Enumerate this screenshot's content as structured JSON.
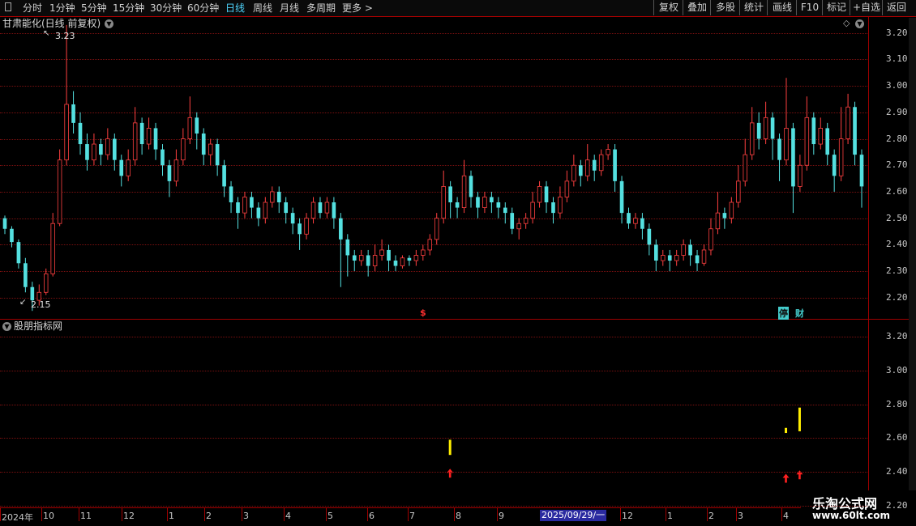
{
  "toolbar": {
    "periods": [
      "分时",
      "1分钟",
      "5分钟",
      "15分钟",
      "30分钟",
      "60分钟",
      "日线",
      "周线",
      "月线",
      "多周期",
      "更多 >"
    ],
    "active_period": "日线",
    "right_buttons": [
      "复权",
      "叠加",
      "多股",
      "统计",
      "画线",
      "F10",
      "标记",
      "+自选",
      "返回"
    ]
  },
  "main_panel": {
    "title": "甘肃能化(日线 前复权)",
    "y_ticks": [
      "3.20",
      "3.10",
      "3.00",
      "2.90",
      "2.80",
      "2.70",
      "2.60",
      "2.50",
      "2.40",
      "2.30",
      "2.20"
    ],
    "high_label": "3.23",
    "low_label": "2.15",
    "tag_s": "$",
    "tag_ting": "停",
    "tag_cai": "财"
  },
  "sub_panel": {
    "title": "股朋指标网",
    "y_ticks": [
      "3.20",
      "3.00",
      "2.80",
      "2.60",
      "2.40",
      "2.20"
    ]
  },
  "x_axis": {
    "labels": [
      "2024年",
      "10",
      "11",
      "12",
      "1",
      "2",
      "3",
      "4",
      "5",
      "6",
      "7",
      "8",
      "9",
      "12",
      "1",
      "2",
      "3",
      "4"
    ],
    "selected_date": "2025/09/29/一"
  },
  "watermark": {
    "line1": "乐淘公式网",
    "line2": "www.60lt.com"
  },
  "colors": {
    "up": "#ff4040",
    "down": "#54e0e0",
    "signal": "#ffee00",
    "arrow": "#ff2020"
  },
  "chart_data": {
    "type": "candlestick",
    "ylim": [
      2.12,
      3.26
    ],
    "candles": [
      [
        2.5,
        2.46,
        2.51,
        2.44
      ],
      [
        2.46,
        2.41,
        2.47,
        2.39
      ],
      [
        2.41,
        2.33,
        2.42,
        2.31
      ],
      [
        2.33,
        2.24,
        2.35,
        2.22
      ],
      [
        2.24,
        2.19,
        2.26,
        2.15
      ],
      [
        2.19,
        2.22,
        2.25,
        2.17
      ],
      [
        2.22,
        2.29,
        2.31,
        2.21
      ],
      [
        2.29,
        2.48,
        2.52,
        2.28
      ],
      [
        2.48,
        2.72,
        2.76,
        2.47
      ],
      [
        2.72,
        2.93,
        3.23,
        2.7
      ],
      [
        2.93,
        2.86,
        2.98,
        2.82
      ],
      [
        2.86,
        2.78,
        2.9,
        2.74
      ],
      [
        2.78,
        2.72,
        2.82,
        2.68
      ],
      [
        2.72,
        2.78,
        2.82,
        2.7
      ],
      [
        2.78,
        2.74,
        2.8,
        2.7
      ],
      [
        2.74,
        2.8,
        2.84,
        2.72
      ],
      [
        2.8,
        2.72,
        2.82,
        2.68
      ],
      [
        2.72,
        2.66,
        2.74,
        2.62
      ],
      [
        2.66,
        2.72,
        2.76,
        2.64
      ],
      [
        2.72,
        2.86,
        2.92,
        2.7
      ],
      [
        2.86,
        2.78,
        2.88,
        2.74
      ],
      [
        2.78,
        2.84,
        2.88,
        2.76
      ],
      [
        2.84,
        2.76,
        2.86,
        2.72
      ],
      [
        2.76,
        2.7,
        2.78,
        2.66
      ],
      [
        2.7,
        2.64,
        2.72,
        2.58
      ],
      [
        2.64,
        2.72,
        2.76,
        2.62
      ],
      [
        2.72,
        2.8,
        2.84,
        2.7
      ],
      [
        2.8,
        2.88,
        2.96,
        2.78
      ],
      [
        2.88,
        2.82,
        2.9,
        2.76
      ],
      [
        2.82,
        2.74,
        2.84,
        2.7
      ],
      [
        2.74,
        2.78,
        2.8,
        2.7
      ],
      [
        2.78,
        2.7,
        2.8,
        2.66
      ],
      [
        2.7,
        2.62,
        2.72,
        2.58
      ],
      [
        2.62,
        2.56,
        2.64,
        2.52
      ],
      [
        2.56,
        2.52,
        2.58,
        2.46
      ],
      [
        2.52,
        2.58,
        2.6,
        2.5
      ],
      [
        2.58,
        2.54,
        2.6,
        2.5
      ],
      [
        2.54,
        2.5,
        2.56,
        2.47
      ],
      [
        2.5,
        2.56,
        2.58,
        2.48
      ],
      [
        2.56,
        2.6,
        2.62,
        2.54
      ],
      [
        2.6,
        2.56,
        2.62,
        2.52
      ],
      [
        2.56,
        2.52,
        2.58,
        2.48
      ],
      [
        2.52,
        2.48,
        2.54,
        2.44
      ],
      [
        2.48,
        2.44,
        2.5,
        2.38
      ],
      [
        2.44,
        2.5,
        2.52,
        2.42
      ],
      [
        2.5,
        2.56,
        2.58,
        2.48
      ],
      [
        2.56,
        2.52,
        2.58,
        2.5
      ],
      [
        2.52,
        2.56,
        2.58,
        2.5
      ],
      [
        2.56,
        2.5,
        2.58,
        2.46
      ],
      [
        2.5,
        2.42,
        2.52,
        2.24
      ],
      [
        2.42,
        2.36,
        2.44,
        2.28
      ],
      [
        2.36,
        2.34,
        2.38,
        2.3
      ],
      [
        2.34,
        2.36,
        2.38,
        2.32
      ],
      [
        2.36,
        2.32,
        2.38,
        2.28
      ],
      [
        2.32,
        2.36,
        2.4,
        2.3
      ],
      [
        2.36,
        2.38,
        2.42,
        2.34
      ],
      [
        2.38,
        2.34,
        2.4,
        2.3
      ],
      [
        2.34,
        2.32,
        2.36,
        2.3
      ],
      [
        2.32,
        2.35,
        2.36,
        2.31
      ],
      [
        2.35,
        2.34,
        2.36,
        2.32
      ],
      [
        2.34,
        2.36,
        2.38,
        2.32
      ],
      [
        2.36,
        2.38,
        2.4,
        2.34
      ],
      [
        2.38,
        2.42,
        2.44,
        2.36
      ],
      [
        2.42,
        2.5,
        2.52,
        2.4
      ],
      [
        2.5,
        2.62,
        2.68,
        2.48
      ],
      [
        2.62,
        2.56,
        2.64,
        2.5
      ],
      [
        2.56,
        2.54,
        2.58,
        2.5
      ],
      [
        2.54,
        2.66,
        2.72,
        2.52
      ],
      [
        2.66,
        2.58,
        2.68,
        2.54
      ],
      [
        2.58,
        2.54,
        2.6,
        2.5
      ],
      [
        2.54,
        2.58,
        2.6,
        2.52
      ],
      [
        2.58,
        2.56,
        2.6,
        2.52
      ],
      [
        2.56,
        2.54,
        2.58,
        2.5
      ],
      [
        2.54,
        2.52,
        2.56,
        2.48
      ],
      [
        2.52,
        2.46,
        2.54,
        2.44
      ],
      [
        2.46,
        2.48,
        2.5,
        2.42
      ],
      [
        2.48,
        2.5,
        2.52,
        2.46
      ],
      [
        2.5,
        2.56,
        2.6,
        2.48
      ],
      [
        2.56,
        2.62,
        2.64,
        2.54
      ],
      [
        2.62,
        2.56,
        2.64,
        2.52
      ],
      [
        2.56,
        2.52,
        2.58,
        2.48
      ],
      [
        2.52,
        2.58,
        2.62,
        2.5
      ],
      [
        2.58,
        2.64,
        2.68,
        2.56
      ],
      [
        2.64,
        2.7,
        2.74,
        2.62
      ],
      [
        2.7,
        2.66,
        2.72,
        2.62
      ],
      [
        2.66,
        2.72,
        2.78,
        2.64
      ],
      [
        2.72,
        2.68,
        2.74,
        2.64
      ],
      [
        2.68,
        2.74,
        2.76,
        2.66
      ],
      [
        2.74,
        2.76,
        2.78,
        2.72
      ],
      [
        2.76,
        2.64,
        2.78,
        2.6
      ],
      [
        2.64,
        2.52,
        2.66,
        2.48
      ],
      [
        2.52,
        2.48,
        2.54,
        2.46
      ],
      [
        2.48,
        2.5,
        2.52,
        2.46
      ],
      [
        2.5,
        2.46,
        2.52,
        2.42
      ],
      [
        2.46,
        2.4,
        2.48,
        2.36
      ],
      [
        2.4,
        2.34,
        2.42,
        2.3
      ],
      [
        2.34,
        2.36,
        2.38,
        2.32
      ],
      [
        2.36,
        2.34,
        2.38,
        2.3
      ],
      [
        2.34,
        2.36,
        2.38,
        2.32
      ],
      [
        2.36,
        2.4,
        2.42,
        2.34
      ],
      [
        2.4,
        2.36,
        2.42,
        2.32
      ],
      [
        2.36,
        2.33,
        2.38,
        2.3
      ],
      [
        2.33,
        2.38,
        2.4,
        2.32
      ],
      [
        2.38,
        2.46,
        2.5,
        2.36
      ],
      [
        2.46,
        2.52,
        2.6,
        2.44
      ],
      [
        2.52,
        2.5,
        2.54,
        2.46
      ],
      [
        2.5,
        2.56,
        2.58,
        2.48
      ],
      [
        2.56,
        2.64,
        2.7,
        2.54
      ],
      [
        2.64,
        2.74,
        2.8,
        2.62
      ],
      [
        2.74,
        2.86,
        2.92,
        2.72
      ],
      [
        2.86,
        2.8,
        2.9,
        2.76
      ],
      [
        2.8,
        2.88,
        2.94,
        2.78
      ],
      [
        2.88,
        2.8,
        2.9,
        2.72
      ],
      [
        2.8,
        2.72,
        2.82,
        2.64
      ],
      [
        2.72,
        2.84,
        3.03,
        2.7
      ],
      [
        2.84,
        2.62,
        2.86,
        2.52
      ],
      [
        2.62,
        2.7,
        2.74,
        2.6
      ],
      [
        2.7,
        2.88,
        2.96,
        2.68
      ],
      [
        2.88,
        2.78,
        2.9,
        2.74
      ],
      [
        2.78,
        2.84,
        2.88,
        2.76
      ],
      [
        2.84,
        2.74,
        2.86,
        2.7
      ],
      [
        2.74,
        2.66,
        2.76,
        2.6
      ],
      [
        2.66,
        2.8,
        2.92,
        2.64
      ],
      [
        2.8,
        2.92,
        2.97,
        2.78
      ],
      [
        2.92,
        2.74,
        2.94,
        2.7
      ],
      [
        2.74,
        2.62,
        2.76,
        2.54
      ]
    ],
    "signals": [
      {
        "index": 64,
        "top": 2.59,
        "bottom": 2.5,
        "arrow": 2.39
      },
      {
        "index": 113,
        "top": 2.66,
        "bottom": 2.63,
        "arrow": 2.36
      },
      {
        "index": 115,
        "top": 2.78,
        "bottom": 2.64,
        "arrow": 2.38
      }
    ],
    "sub_ylim": [
      2.19,
      3.3
    ]
  }
}
